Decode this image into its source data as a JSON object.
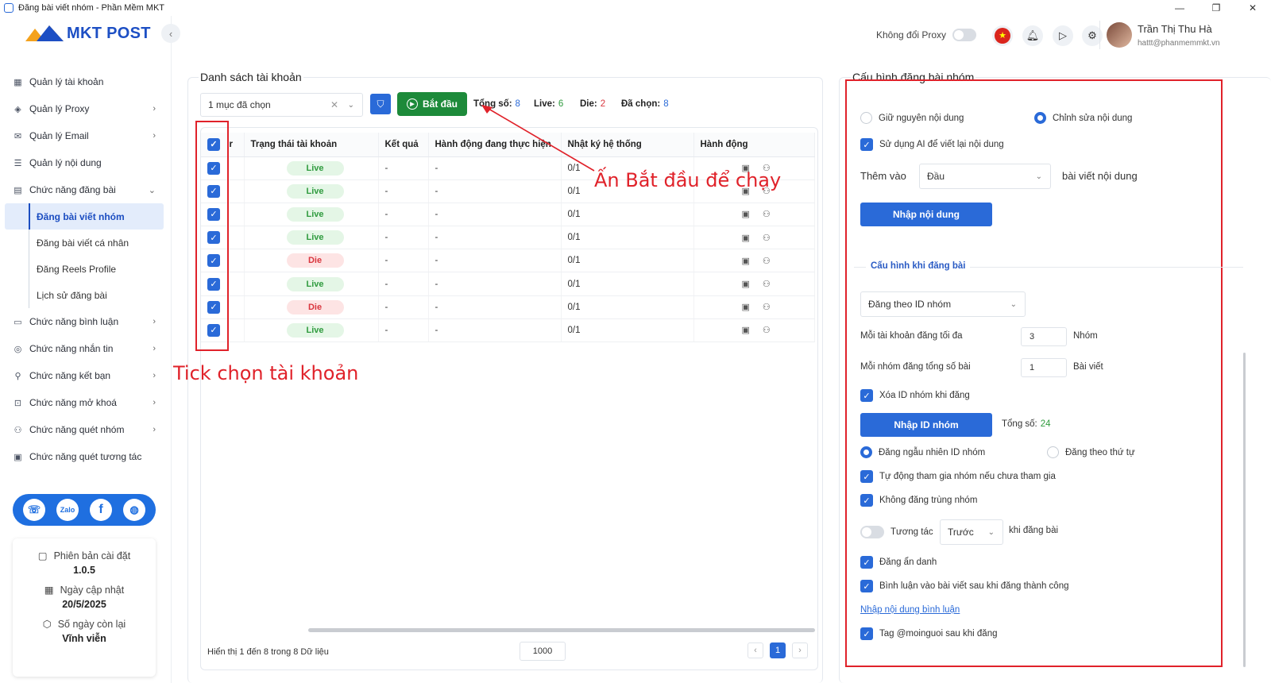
{
  "window": {
    "title": "Đăng bài viết nhóm - Phần Mềm MKT",
    "min": "—",
    "max": "❐",
    "close": "✕"
  },
  "brand": {
    "logo_text": "MKT POST"
  },
  "sidebar": {
    "items": [
      {
        "label": "Quản lý tài khoản",
        "icon": "grid-icon"
      },
      {
        "label": "Quản lý Proxy",
        "icon": "layers-icon",
        "chev": "›"
      },
      {
        "label": "Quản lý Email",
        "icon": "mail-icon",
        "chev": "›"
      },
      {
        "label": "Quản lý nội dung",
        "icon": "content-icon"
      },
      {
        "label": "Chức năng đăng bài",
        "icon": "post-icon",
        "chev": "⌄"
      }
    ],
    "subitems": [
      {
        "label": "Đăng bài viết nhóm"
      },
      {
        "label": "Đăng bài viết cá nhân"
      },
      {
        "label": "Đăng Reels Profile"
      },
      {
        "label": "Lịch sử đăng bài"
      }
    ],
    "items2": [
      {
        "label": "Chức năng bình luận",
        "icon": "comment-icon",
        "chev": "›"
      },
      {
        "label": "Chức năng nhắn tin",
        "icon": "chat-icon",
        "chev": "›"
      },
      {
        "label": "Chức năng kết bạn",
        "icon": "add-friend-icon",
        "chev": "›"
      },
      {
        "label": "Chức năng mở khoá",
        "icon": "lock-icon",
        "chev": "›"
      },
      {
        "label": "Chức năng quét nhóm",
        "icon": "group-icon",
        "chev": "›"
      },
      {
        "label": "Chức năng quét tương tác",
        "icon": "scan-icon"
      }
    ],
    "info": {
      "version_label": "Phiên bản cài đặt",
      "version": "1.0.5",
      "update_label": "Ngày cập nhật",
      "update": "20/5/2025",
      "days_label": "Số ngày còn lại",
      "days": "Vĩnh viễn"
    }
  },
  "topbar": {
    "proxy_label": "Không đổi Proxy",
    "user_name": "Trần Thị Thu Hà",
    "user_email": "hattt@phanmemmkt.vn"
  },
  "accounts": {
    "title": "Danh sách tài khoản",
    "select_value": "1 mục đã chọn",
    "start_label": "Bắt đầu",
    "stats": {
      "total_label": "Tổng số:",
      "total": "8",
      "live_label": "Live:",
      "live": "6",
      "die_label": "Die:",
      "die": "2",
      "selected_label": "Đã chọn:",
      "selected": "8"
    },
    "columns": [
      "r",
      "Trạng thái tài khoản",
      "Kết quả",
      "Hành động đang thực hiện",
      "Nhật ký hệ thống",
      "Hành động"
    ],
    "rows": [
      {
        "status": "Live",
        "result": "-",
        "action": "-",
        "log": "0/1"
      },
      {
        "status": "Live",
        "result": "-",
        "action": "-",
        "log": "0/1"
      },
      {
        "status": "Live",
        "result": "-",
        "action": "-",
        "log": "0/1"
      },
      {
        "status": "Live",
        "result": "-",
        "action": "-",
        "log": "0/1"
      },
      {
        "status": "Die",
        "result": "-",
        "action": "-",
        "log": "0/1"
      },
      {
        "status": "Live",
        "result": "-",
        "action": "-",
        "log": "0/1"
      },
      {
        "status": "Die",
        "result": "-",
        "action": "-",
        "log": "0/1"
      },
      {
        "status": "Live",
        "result": "-",
        "action": "-",
        "log": "0/1"
      }
    ],
    "footer": "Hiển thị 1 đến 8 trong 8 Dữ liệu",
    "page_size": "1000",
    "page": "1"
  },
  "annotations": {
    "start_hint": "Ấn Bắt đầu để chạy",
    "tick_hint": "Tick chọn tài khoản"
  },
  "config": {
    "title": "Cấu hình đăng bài nhóm",
    "keep_content": "Giữ nguyên nội dung",
    "edit_content": "Chỉnh sửa nội dung",
    "use_ai": "Sử dụng AI để viết lại nội dung",
    "add_to": "Thêm vào",
    "position": "Đầu",
    "content_suffix": "bài viết nội dung",
    "import_content": "Nhập nội dung",
    "section": "Cấu hình khi đăng bài",
    "post_by": "Đăng theo ID nhóm",
    "max_per_account_label": "Mỗi tài khoản đăng tối đa",
    "max_per_account": "3",
    "max_unit": "Nhóm",
    "posts_per_group_label": "Mỗi nhóm đăng tổng số bài",
    "posts_per_group": "1",
    "posts_unit": "Bài viết",
    "delete_id": "Xóa ID nhóm khi đăng",
    "import_id": "Nhập ID nhóm",
    "id_total_label": "Tổng số:",
    "id_total": "24",
    "random_order": "Đăng ngẫu nhiên ID nhóm",
    "sequential": "Đăng theo thứ tự",
    "auto_join": "Tự động tham gia nhóm nếu chưa tham gia",
    "no_dup": "Không đăng trùng nhóm",
    "interact": "Tương tác",
    "interact_when": "Trước",
    "interact_suffix": "khi đăng bài",
    "anonymous": "Đăng ẩn danh",
    "comment_after": "Bình luận vào bài viết sau khi đăng thành công",
    "comment_link": "Nhập nội dung bình luận",
    "tag": "Tag @moinguoi sau khi đăng"
  },
  "colors": {
    "accent": "#2a6ad8",
    "start": "#1d8a3a",
    "annotation": "#e0222a"
  }
}
